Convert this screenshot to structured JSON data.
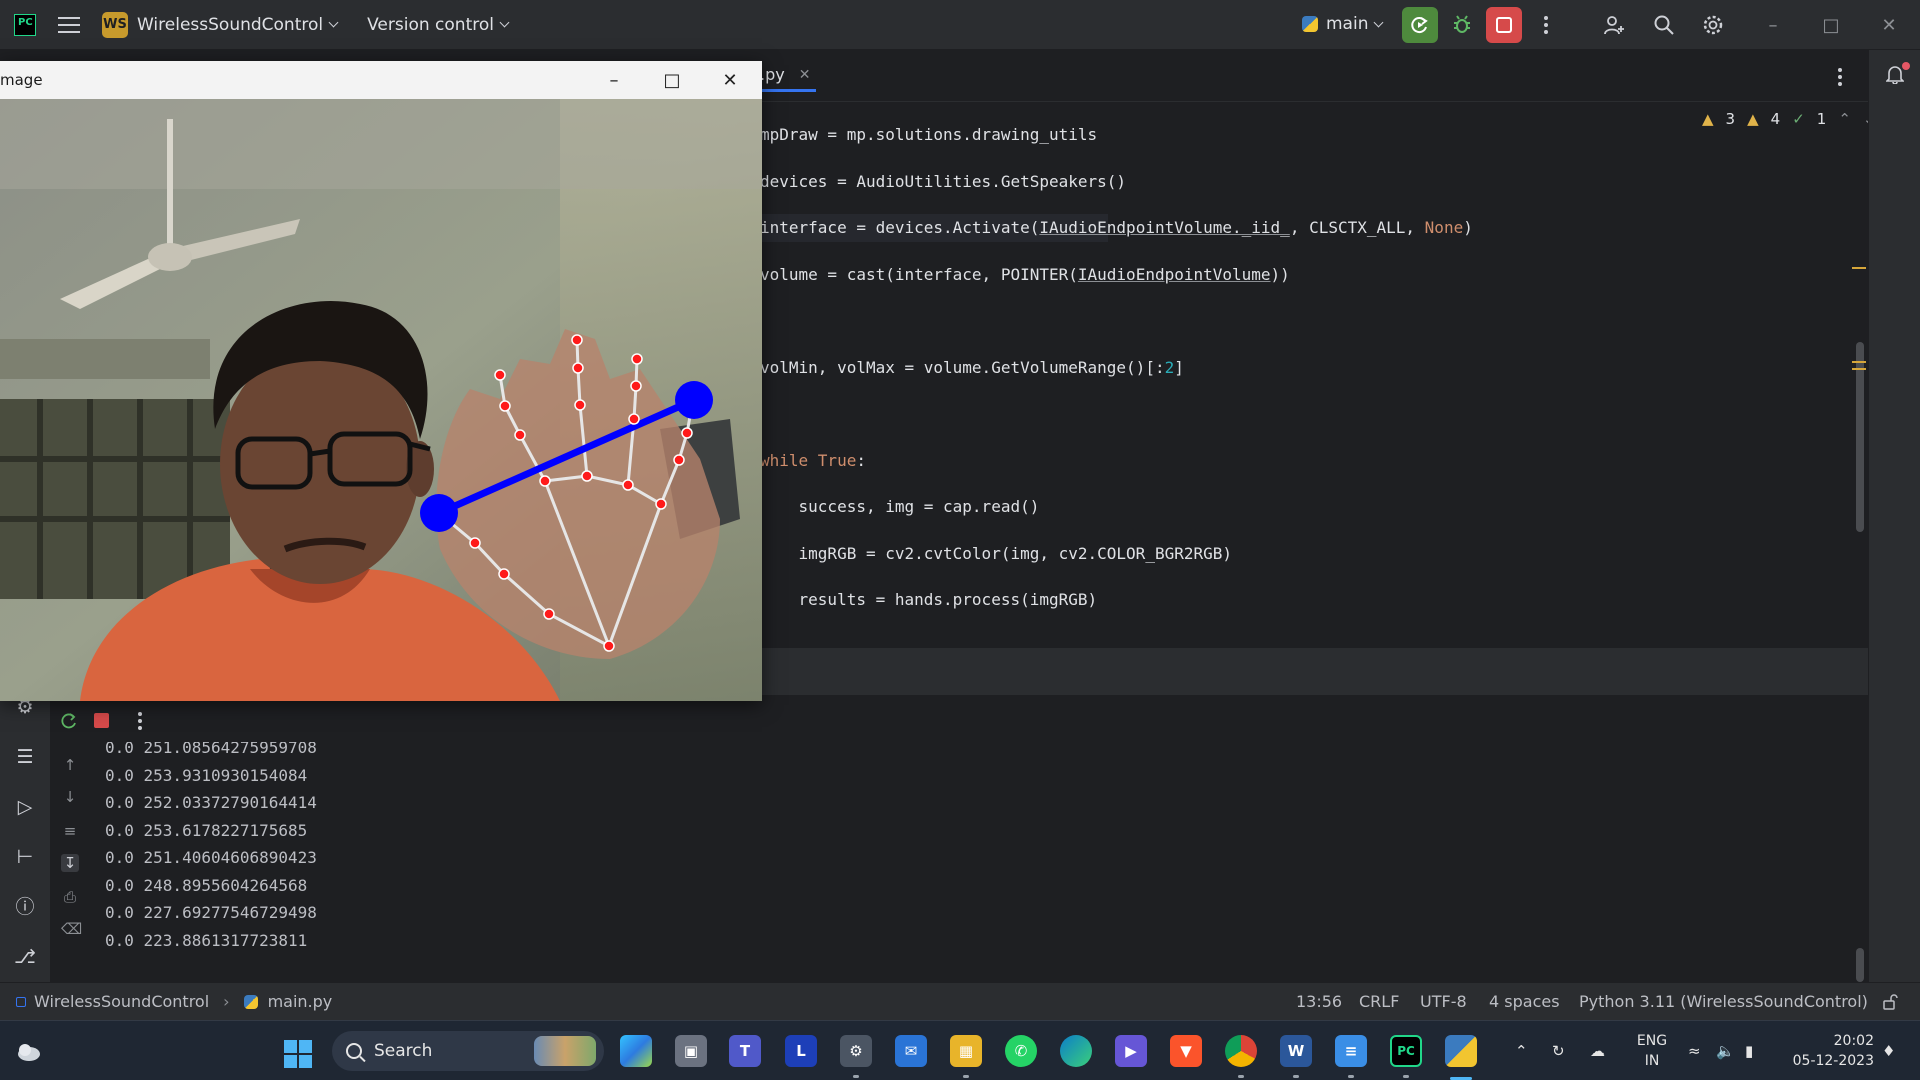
{
  "toolbar": {
    "logo_text": "PC",
    "project_badge": "WS",
    "project_name": "WirelessSoundControl",
    "version_control": "Version control",
    "branch": "main",
    "colors": {
      "run": "#4e8a3d",
      "stop": "#d64a4a",
      "badge": "#c79a2c"
    }
  },
  "editor": {
    "tab_label": ".py",
    "inspections": {
      "warnings": "3",
      "weak_warnings": "4",
      "typos": "1"
    }
  },
  "image_window": {
    "title": "mage"
  },
  "console": {
    "lines": [
      "0.0 251.08564275959708",
      "0.0 253.9310930154084",
      "0.0 252.03372790164414",
      "0.0 253.6178227175685",
      "0.0 251.40604606890423",
      "0.0 248.8955604264568",
      "0.0 227.69277546729498",
      "0.0 223.8861317723811"
    ]
  },
  "status": {
    "project": "WirelessSoundControl",
    "file": "main.py",
    "position": "13:56",
    "line_sep": "CRLF",
    "encoding": "UTF-8",
    "indent": "4 spaces",
    "interpreter": "Python 3.11 (WirelessSoundControl)"
  },
  "taskbar": {
    "search_label": "Search",
    "app_letter": "L",
    "lang_top": "ENG",
    "lang_bottom": "IN",
    "time": "20:02",
    "date": "05-12-2023"
  }
}
